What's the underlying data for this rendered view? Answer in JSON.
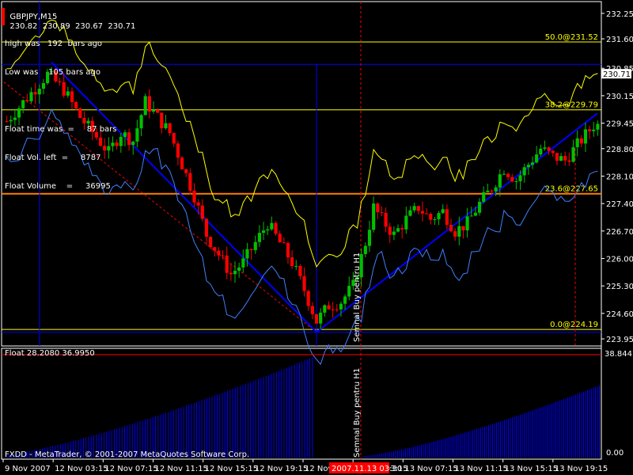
{
  "header": {
    "symbol": "GBPJPY,M15",
    "ohlc": "230.82  230.89  230.67  230.71"
  },
  "info_box": [
    "high was   192  bars ago",
    "Low was    105 bars ago",
    "",
    "Float time was  =     87 bars",
    "Float Vol. left  =     8787",
    "Float Volume    =     36995"
  ],
  "indicator": {
    "title": "Float 28.2080 36.9950",
    "scale_top": "38.8447",
    "scale_bottom": "0.00"
  },
  "copyright": "FXDD - MetaTrader, © 2001-2007 MetaQuotes Software Corp.",
  "signal_label": "Semnal Buy pentru H1",
  "highlighted_time": "2007.11.13 03:30",
  "current_price": "230.71",
  "colors": {
    "background": "#000000",
    "bull": "#00c000",
    "bear": "#ff0000",
    "yellow": "#ffff00",
    "blue": "#0000ff",
    "light_blue": "#4080ff",
    "orange": "#ff8000",
    "grid": "#ffffff"
  },
  "chart_data": {
    "type": "line",
    "price_axis": [
      "232.25",
      "231.60",
      "230.85",
      "230.15",
      "229.45",
      "228.80",
      "228.10",
      "227.40",
      "226.70",
      "226.00",
      "225.30",
      "224.60",
      "223.95"
    ],
    "time_axis": [
      "9 Nov 2007",
      "12 Nov 03:15",
      "12 Nov 07:15",
      "12 Nov 11:15",
      "12 Nov 15:15",
      "12 Nov 19:15",
      "12 Nov 23:15",
      "13 Nov 03:15",
      "13 Nov 07:15",
      "13 Nov 11:15",
      "13 Nov 15:15",
      "13 Nov 19:15"
    ],
    "fibo_levels": [
      {
        "label": "50.0@231.52",
        "value": 231.52
      },
      {
        "label": "38.2@229.79",
        "value": 229.79
      },
      {
        "label": "23.6@227.65",
        "value": 227.65
      },
      {
        "label": "0.0@224.19",
        "value": 224.19
      }
    ],
    "close_path": [
      [
        0,
        229.5
      ],
      [
        5,
        230.1
      ],
      [
        10,
        230.7
      ],
      [
        14,
        230.3
      ],
      [
        18,
        229.6
      ],
      [
        22,
        229.1
      ],
      [
        25,
        228.7
      ],
      [
        28,
        229.2
      ],
      [
        31,
        229.0
      ],
      [
        34,
        230.0
      ],
      [
        37,
        229.6
      ],
      [
        40,
        229.2
      ],
      [
        43,
        228.4
      ],
      [
        46,
        227.6
      ],
      [
        49,
        226.6
      ],
      [
        52,
        226.1
      ],
      [
        55,
        225.6
      ],
      [
        58,
        225.9
      ],
      [
        61,
        226.4
      ],
      [
        64,
        226.9
      ],
      [
        67,
        226.4
      ],
      [
        70,
        225.9
      ],
      [
        73,
        225.2
      ],
      [
        76,
        224.4
      ],
      [
        79,
        224.8
      ],
      [
        82,
        224.9
      ],
      [
        85,
        225.3
      ],
      [
        88,
        226.4
      ],
      [
        90,
        227.3
      ],
      [
        92,
        227.0
      ],
      [
        95,
        226.6
      ],
      [
        98,
        227.0
      ],
      [
        101,
        227.3
      ],
      [
        104,
        227.0
      ],
      [
        107,
        227.2
      ],
      [
        110,
        226.7
      ],
      [
        113,
        226.9
      ],
      [
        116,
        227.4
      ],
      [
        119,
        227.8
      ],
      [
        122,
        228.3
      ],
      [
        125,
        228.0
      ],
      [
        128,
        228.4
      ],
      [
        131,
        228.8
      ],
      [
        134,
        228.6
      ],
      [
        137,
        228.5
      ],
      [
        140,
        228.9
      ],
      [
        144,
        229.4
      ]
    ]
  }
}
